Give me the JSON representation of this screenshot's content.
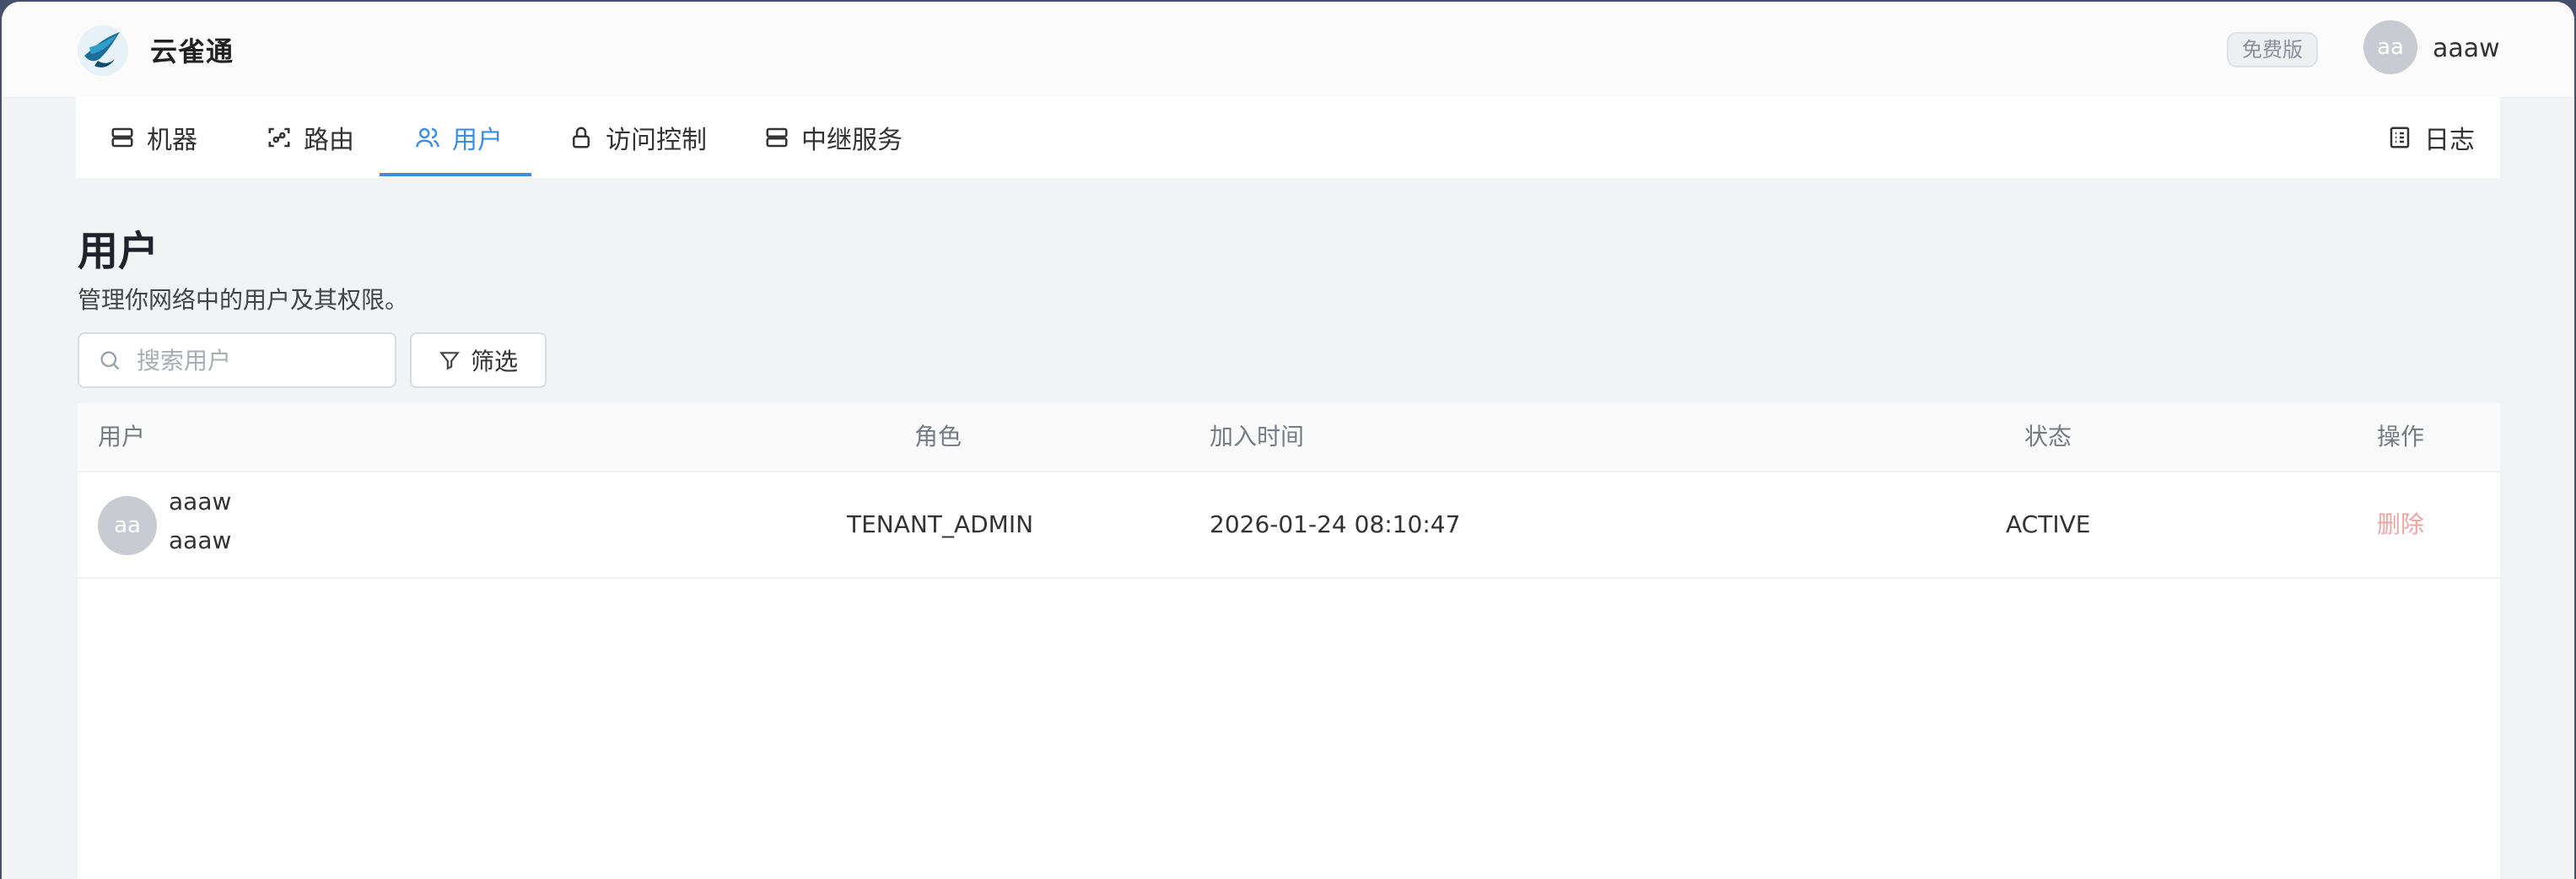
{
  "app": {
    "brand": "云雀通",
    "plan_badge": "免费版",
    "user": {
      "initials": "aa",
      "name": "aaaw"
    }
  },
  "nav": {
    "items": [
      {
        "label": "机器",
        "icon": "server-icon"
      },
      {
        "label": "路由",
        "icon": "route-scan-icon"
      },
      {
        "label": "用户",
        "icon": "users-icon",
        "active": true
      },
      {
        "label": "访问控制",
        "icon": "lock-icon"
      },
      {
        "label": "中继服务",
        "icon": "relay-server-icon"
      }
    ],
    "log": {
      "label": "日志",
      "icon": "log-icon"
    }
  },
  "page": {
    "title": "用户",
    "description": "管理你网络中的用户及其权限。"
  },
  "toolbar": {
    "search_placeholder": "搜索用户",
    "search_value": "",
    "filter_label": "筛选"
  },
  "table": {
    "columns": [
      "用户",
      "角色",
      "加入时间",
      "状态",
      "操作"
    ],
    "rows": [
      {
        "initials": "aa",
        "name": "aaaw",
        "email": "aaaw",
        "role": "TENANT_ADMIN",
        "joined": "2026-01-24 08:10:47",
        "status": "ACTIVE",
        "action": "删除"
      }
    ]
  },
  "colors": {
    "accent": "#3a8ee6",
    "danger_muted": "#f0a3a3",
    "avatar": "#c8cbd1"
  }
}
